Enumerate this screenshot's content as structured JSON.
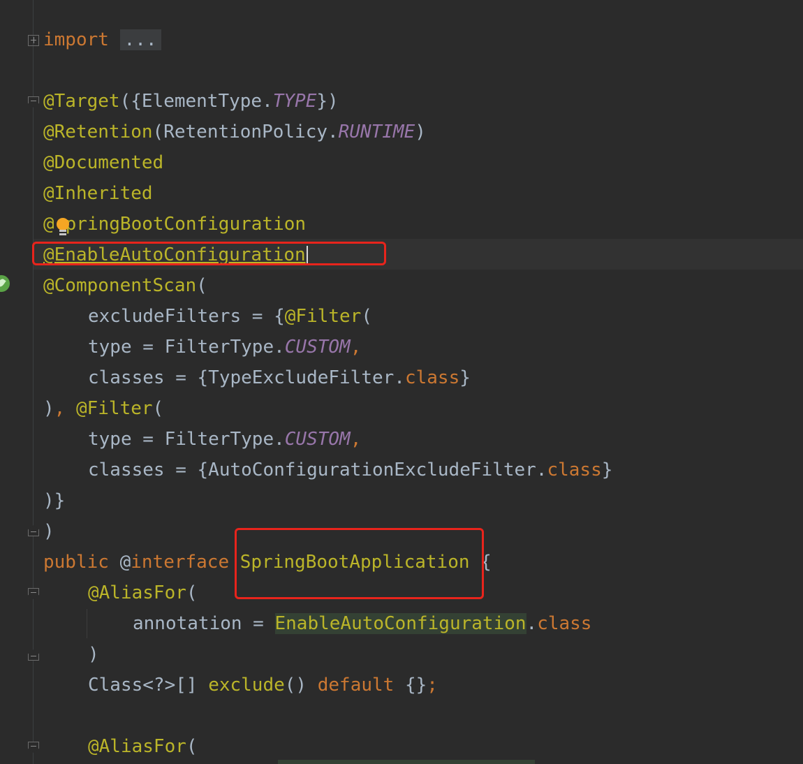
{
  "code": {
    "l1": {
      "kw": "import",
      "folded": "..."
    },
    "l2": {
      "ann": "@Target",
      "open": "({ElementType.",
      "const": "TYPE",
      "close": "})"
    },
    "l3": {
      "ann": "@Retention",
      "open": "(RetentionPolicy.",
      "const": "RUNTIME",
      "close": ")"
    },
    "l4": {
      "ann": "@Documented"
    },
    "l5": {
      "ann": "@Inherited"
    },
    "l6": {
      "at": "@",
      "rest": "pringBootConfiguration"
    },
    "l7": {
      "ann": "@EnableAutoConfiguration"
    },
    "l8": {
      "ann": "@ComponentScan",
      "open": "("
    },
    "l9": {
      "plain": "excludeFilters = {",
      "ann": "@Filter",
      "open": "("
    },
    "l10": {
      "plain": "type = FilterType.",
      "const": "CUSTOM",
      "comma": ","
    },
    "l11": {
      "plain": "classes = {TypeExcludeFilter.",
      "kw": "class",
      "close": "}"
    },
    "l12": {
      "close": ")",
      "comma": ",",
      "space": " ",
      "ann": "@Filter",
      "open": "("
    },
    "l13": {
      "plain": "type = FilterType.",
      "const": "CUSTOM",
      "comma": ","
    },
    "l14": {
      "plain": "classes = {AutoConfigurationExcludeFilter.",
      "kw": "class",
      "close": "}"
    },
    "l15": {
      "plain": ")}"
    },
    "l16": {
      "plain": ")"
    },
    "l17": {
      "kw1": "public",
      "at": "@",
      "kw2": "interface",
      "name": "SpringBootApplication",
      "brace": "{"
    },
    "l18": {
      "ann": "@AliasFor",
      "open": "("
    },
    "l19": {
      "plain": "annotation = ",
      "ref": "EnableAutoConfiguration",
      "dot": ".",
      "kw": "class"
    },
    "l20": {
      "plain": ")"
    },
    "l21": {
      "plain1": "Class<?>[] ",
      "method": "exclude",
      "plain2": "() ",
      "kw": "default",
      "plain3": " {}",
      "semi": ";"
    },
    "l22": {
      "ann": "@AliasFor",
      "open": "("
    }
  },
  "colors": {
    "background": "#2b2b2b",
    "annotation": "#bbb529",
    "keyword": "#cc7832",
    "constant": "#9876aa",
    "text": "#a9b7c6",
    "highlight_box": "#e8241c"
  },
  "icons": [
    "fold-icon",
    "lightbulb-icon",
    "spring-bean-icon"
  ]
}
